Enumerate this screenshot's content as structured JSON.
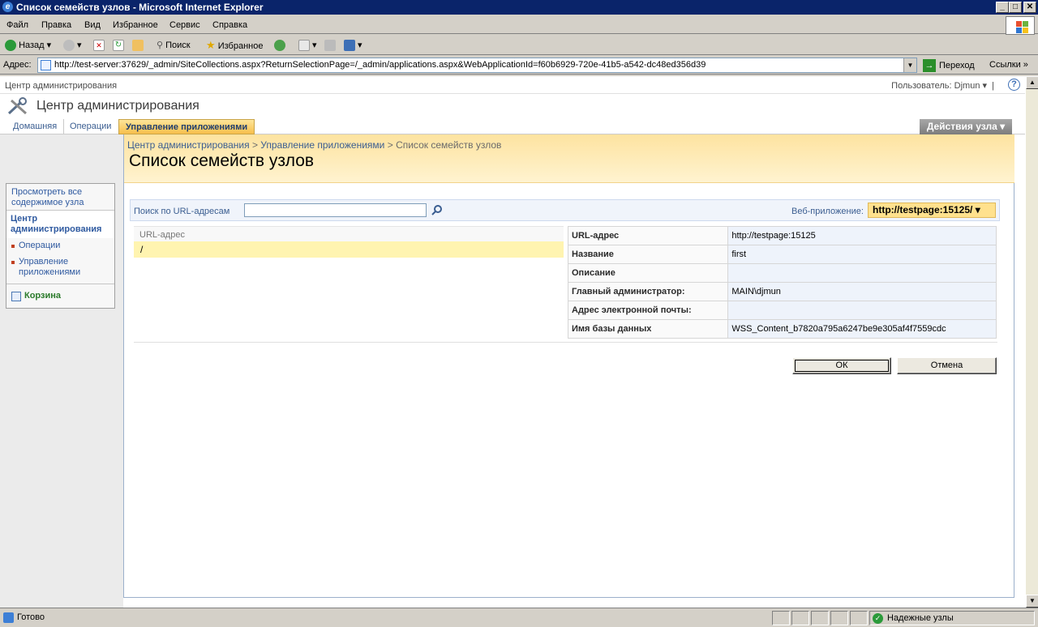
{
  "window": {
    "title": "Список семейств узлов - Microsoft Internet Explorer",
    "min": "_",
    "max": "□",
    "close": "✕"
  },
  "menu": [
    "Файл",
    "Правка",
    "Вид",
    "Избранное",
    "Сервис",
    "Справка"
  ],
  "toolbar": {
    "back": "Назад",
    "search": "Поиск",
    "favorites": "Избранное"
  },
  "address": {
    "label": "Адрес:",
    "url": "http://test-server:37629/_admin/SiteCollections.aspx?ReturnSelectionPage=/_admin/applications.aspx&WebApplicationId=f60b6929-720e-41b5-a542-dc48ed356d39",
    "go": "Переход",
    "links": "Ссылки"
  },
  "sp": {
    "site_name": "Центр администрирования",
    "user": "Пользователь: Djmun",
    "help": "?",
    "app_title": "Центр администрирования",
    "tabs": [
      "Домашняя",
      "Операции",
      "Управление приложениями"
    ],
    "site_actions": "Действия узла",
    "quicknav": {
      "view_all": "Просмотреть все содержимое узла",
      "heading": "Центр администрирования",
      "items": [
        "Операции",
        "Управление приложениями"
      ],
      "recycle": "Корзина"
    },
    "breadcrumb": {
      "crumb1": "Центр администрирования",
      "crumb2": "Управление приложениями",
      "current": "Список семейств узлов",
      "sep": " > "
    },
    "page_title": "Список семейств узлов",
    "search": {
      "label": "Поиск по URL-адресам",
      "value": "",
      "webapp_label": "Веб-приложение:",
      "webapp_value": "http://testpage:15125/"
    },
    "list": {
      "header": "URL-адрес",
      "rows": [
        "/"
      ]
    },
    "details": [
      {
        "k": "URL-адрес",
        "v": "http://testpage:15125"
      },
      {
        "k": "Название",
        "v": "first"
      },
      {
        "k": "Описание",
        "v": ""
      },
      {
        "k": "Главный администратор:",
        "v": "MAIN\\djmun"
      },
      {
        "k": "Адрес электронной почты:",
        "v": ""
      },
      {
        "k": "Имя базы данных",
        "v": "WSS_Content_b7820a795a6247be9e305af4f7559cdc"
      }
    ],
    "ok": "ОК",
    "cancel": "Отмена"
  },
  "status": {
    "text": "Готово",
    "zone": "Надежные узлы"
  },
  "colors": {
    "title_bar": "#0a246a",
    "active_tab": "#f7bf4c",
    "header_band": "#fde3a0",
    "selected_row": "#fff4b0",
    "link": "#3b5e91"
  }
}
